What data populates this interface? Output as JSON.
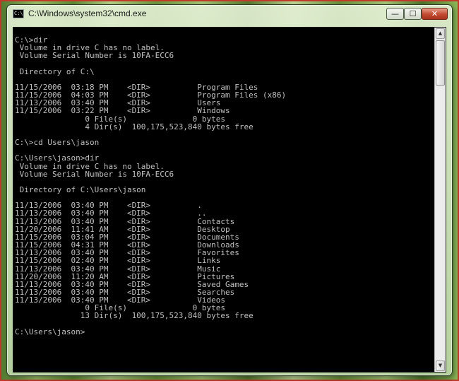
{
  "window": {
    "title": "C:\\Windows\\system32\\cmd.exe",
    "icon": "cmd-icon",
    "buttons": {
      "minimize": "—",
      "maximize": "☐",
      "close": "✕"
    }
  },
  "console": {
    "lines": [
      "C:\\>dir",
      " Volume in drive C has no label.",
      " Volume Serial Number is 10FA-ECC6",
      "",
      " Directory of C:\\",
      "",
      "11/15/2006  03:18 PM    <DIR>          Program Files",
      "11/15/2006  04:03 PM    <DIR>          Program Files (x86)",
      "11/13/2006  03:40 PM    <DIR>          Users",
      "11/15/2006  03:22 PM    <DIR>          Windows",
      "               0 File(s)              0 bytes",
      "               4 Dir(s)  100,175,523,840 bytes free",
      "",
      "C:\\>cd Users\\jason",
      "",
      "C:\\Users\\jason>dir",
      " Volume in drive C has no label.",
      " Volume Serial Number is 10FA-ECC6",
      "",
      " Directory of C:\\Users\\jason",
      "",
      "11/13/2006  03:40 PM    <DIR>          .",
      "11/13/2006  03:40 PM    <DIR>          ..",
      "11/13/2006  03:40 PM    <DIR>          Contacts",
      "11/20/2006  11:41 AM    <DIR>          Desktop",
      "11/15/2006  03:04 PM    <DIR>          Documents",
      "11/15/2006  04:31 PM    <DIR>          Downloads",
      "11/13/2006  03:40 PM    <DIR>          Favorites",
      "11/15/2006  02:40 PM    <DIR>          Links",
      "11/13/2006  03:40 PM    <DIR>          Music",
      "11/20/2006  11:20 AM    <DIR>          Pictures",
      "11/13/2006  03:40 PM    <DIR>          Saved Games",
      "11/13/2006  03:40 PM    <DIR>          Searches",
      "11/13/2006  03:40 PM    <DIR>          Videos",
      "               0 File(s)              0 bytes",
      "              13 Dir(s)  100,175,523,840 bytes free",
      "",
      "C:\\Users\\jason>"
    ]
  },
  "scrollbar": {
    "up_arrow": "▲",
    "down_arrow": "▼"
  },
  "colors": {
    "console_bg": "#000000",
    "console_fg": "#c0c0c0",
    "close_button": "#c24a30"
  }
}
